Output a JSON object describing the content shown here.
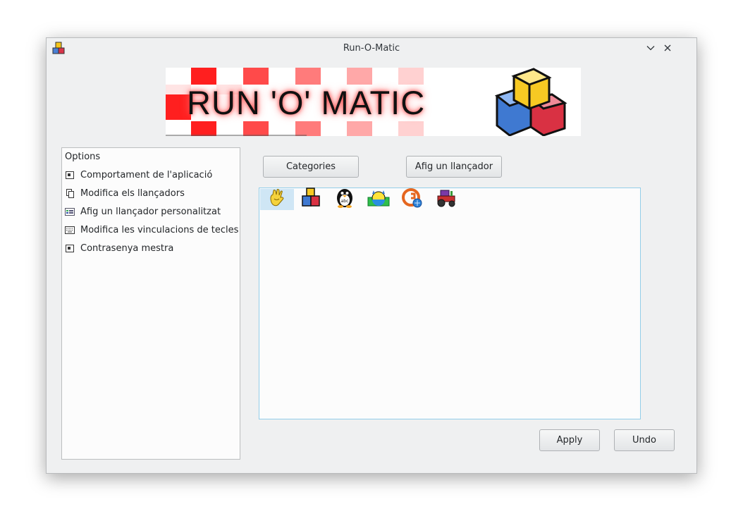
{
  "window": {
    "title": "Run-O-Matic"
  },
  "titlebar": {
    "app_icon": "cubes-icon",
    "minimize_icon": "chevron-down-icon",
    "close_icon": "close-icon"
  },
  "banner": {
    "text": "RUN 'O' MATIC",
    "logo_icon": "cubes-icon"
  },
  "options": {
    "header": "Options",
    "items": [
      {
        "label": "Comportament de l'aplicació",
        "icon": "window-icon"
      },
      {
        "label": "Modifica els llançadors",
        "icon": "copy-icon"
      },
      {
        "label": "Afig un llançador personalitzat",
        "icon": "custom-launcher-icon"
      },
      {
        "label": "Modifica les vinculacions de tecles",
        "icon": "keyboard-icon"
      },
      {
        "label": "Contrasenya mestra",
        "icon": "window-icon"
      }
    ]
  },
  "toolbar": {
    "categories_label": "Categories",
    "add_launcher_label": "Afig un llançador"
  },
  "launchers": [
    {
      "icon": "hand-icon",
      "selected": true
    },
    {
      "icon": "cubes-icon",
      "selected": false
    },
    {
      "icon": "penguin-abc-icon",
      "selected": false
    },
    {
      "icon": "paint-tool-icon",
      "selected": false
    },
    {
      "icon": "globe-g-icon",
      "selected": false
    },
    {
      "icon": "tractor-icon",
      "selected": false
    }
  ],
  "footer": {
    "apply_label": "Apply",
    "undo_label": "Undo"
  },
  "colors": {
    "window_bg": "#eff0f1",
    "accent": "#3daee9",
    "selection": "#cfe6f5"
  }
}
